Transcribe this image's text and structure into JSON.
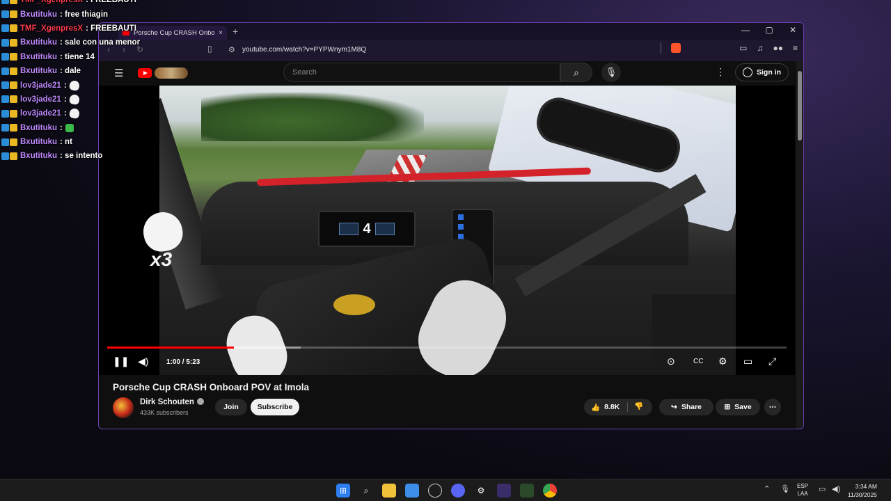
{
  "chat": {
    "lines": [
      {
        "user": "TMF_XgenpresX",
        "msg": ": FREEBAUTI",
        "color": "#ff3b4e"
      },
      {
        "user": "Bxutituku",
        "msg": ": free thiagin",
        "color": "#c08bff"
      },
      {
        "user": "TMF_XgenpresX",
        "msg": ": FREEBAUTI",
        "color": "#ff3b4e"
      },
      {
        "user": "Bxutituku",
        "msg": ": sale con una menor",
        "color": "#c08bff"
      },
      {
        "user": "Bxutituku",
        "msg": ": tiene 14",
        "color": "#c08bff"
      },
      {
        "user": "Bxutituku",
        "msg": ": dale",
        "color": "#c08bff"
      },
      {
        "user": "lov3jade21",
        "msg": " :",
        "color": "#c08bff",
        "emote": "ghost-emote"
      },
      {
        "user": "lov3jade21",
        "msg": " :",
        "color": "#c08bff",
        "emote": "ghost-emote"
      },
      {
        "user": "lov3jade21",
        "msg": " :",
        "color": "#c08bff",
        "emote": "ghost-emote"
      },
      {
        "user": "Bxutituku",
        "msg": " :",
        "color": "#c08bff",
        "emote": "green-emote"
      },
      {
        "user": "Bxutituku",
        "msg": ": nt",
        "color": "#c08bff"
      },
      {
        "user": "Bxutituku",
        "msg": ": se intento",
        "color": "#c08bff"
      }
    ]
  },
  "browser": {
    "tab_title": "Porsche Cup CRASH Onboard",
    "tab_close": "×",
    "new_tab": "+",
    "window_controls": {
      "minimize": "—",
      "maximize": "▢",
      "close": "✕"
    },
    "url": "youtube.com/watch?v=PYPWnym1M8Q",
    "accent": "#6a3fb0"
  },
  "youtube": {
    "search_placeholder": "Search",
    "sign_in": "Sign in",
    "video": {
      "title": "Porsche Cup CRASH Onboard POV at Imola",
      "time": "1:00 / 5:23",
      "progress_fraction": 0.186,
      "buffer_fraction": 0.285,
      "overlay_text": "x3"
    },
    "channel": {
      "name": "Dirk Schouten",
      "subscribers": "433K subscribers",
      "join": "Join",
      "subscribe": "Subscribe"
    },
    "actions": {
      "likes": "8.8K",
      "share": "Share",
      "save": "Save"
    },
    "display_gear": "4"
  },
  "taskbar": {
    "lang": "ESP",
    "lang2": "LAA",
    "time": "3:34 AM",
    "date": "11/30/2025"
  }
}
